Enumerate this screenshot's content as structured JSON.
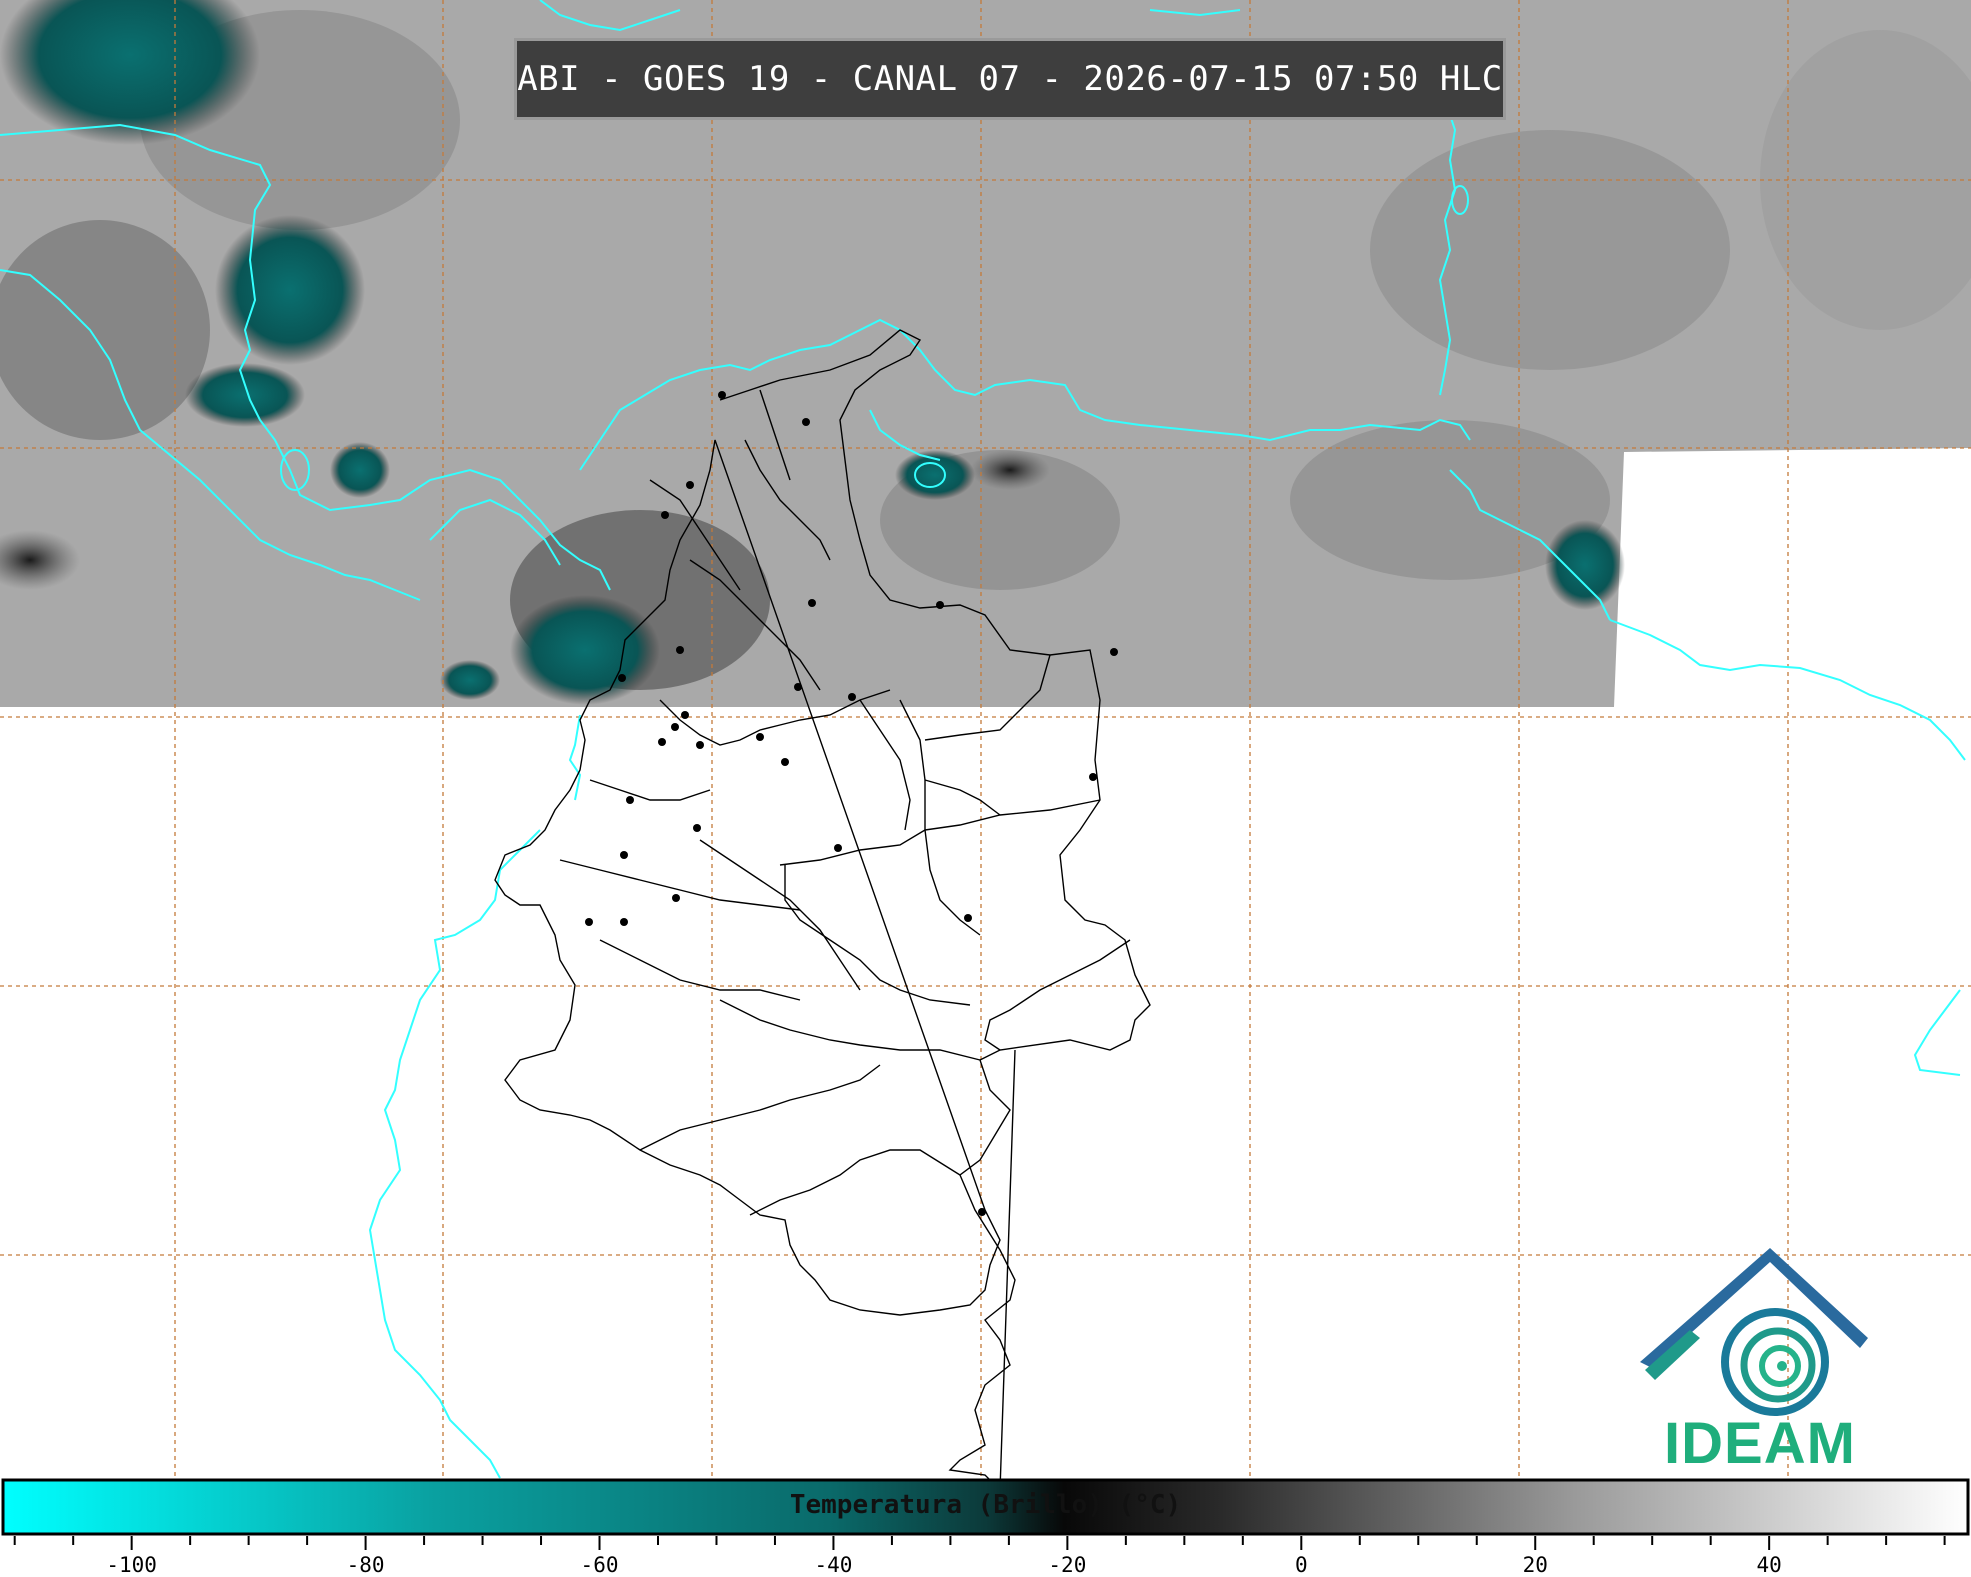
{
  "title": "ABI - GOES 19 - CANAL 07 - 2026-07-15 07:50 HLC",
  "logo": {
    "text": "IDEAM",
    "colors": [
      "#2a5c9e",
      "#1fae7c"
    ]
  },
  "colorbar": {
    "label": "Temperatura (Brillo) (°C)",
    "ticks": [
      "-100",
      "-80",
      "-60",
      "-40",
      "-20",
      "0",
      "20",
      "40"
    ],
    "range": [
      -111,
      57
    ],
    "colors": {
      "cold": "#00ffff",
      "mid": "#0a5a5a",
      "dark": "#0a0a0a",
      "warm": "#ffffff"
    }
  },
  "map": {
    "gridline_color": "#c47a3a",
    "coastline_color": "#33ffff",
    "border_color": "#000000",
    "background_color": "#ffffff",
    "satellite_layer": "grayscale infrared"
  }
}
